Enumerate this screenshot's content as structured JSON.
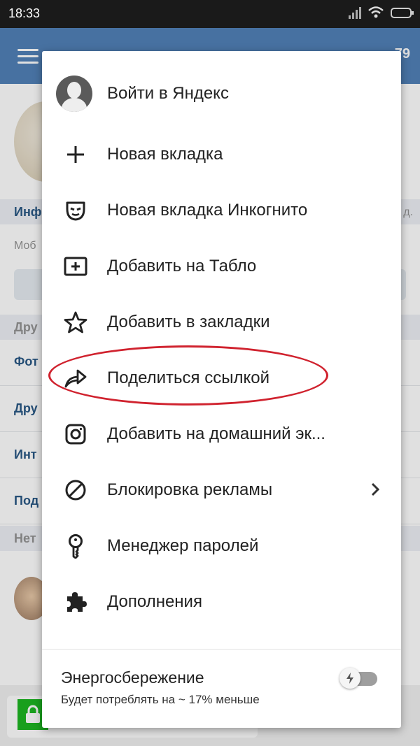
{
  "status_bar": {
    "time": "18:33"
  },
  "background_page": {
    "header_count": "79",
    "rows": [
      "Инф",
      "Моб",
      "Дру",
      "Фот",
      "Дру",
      "Инт",
      "Под",
      "Нет"
    ],
    "right_text": "д."
  },
  "menu": {
    "items": [
      {
        "label": "Войти в Яндекс",
        "icon": "user-avatar-icon"
      },
      {
        "label": "Новая вкладка",
        "icon": "plus-icon"
      },
      {
        "label": "Новая вкладка Инкогнито",
        "icon": "incognito-mask-icon"
      },
      {
        "label": "Добавить на Табло",
        "icon": "add-box-icon"
      },
      {
        "label": "Добавить в закладки",
        "icon": "star-icon"
      },
      {
        "label": "Поделиться ссылкой",
        "icon": "share-arrow-icon"
      },
      {
        "label": "Добавить на домашний эк...",
        "icon": "instagram-icon"
      },
      {
        "label": "Блокировка рекламы",
        "icon": "block-icon"
      },
      {
        "label": "Менеджер паролей",
        "icon": "key-icon"
      },
      {
        "label": "Дополнения",
        "icon": "puzzle-icon"
      }
    ],
    "energy": {
      "title": "Энергосбережение",
      "subtitle": "Будет потреблять на ~ 17% меньше",
      "enabled": false
    }
  },
  "highlight_color": "#d0222e"
}
